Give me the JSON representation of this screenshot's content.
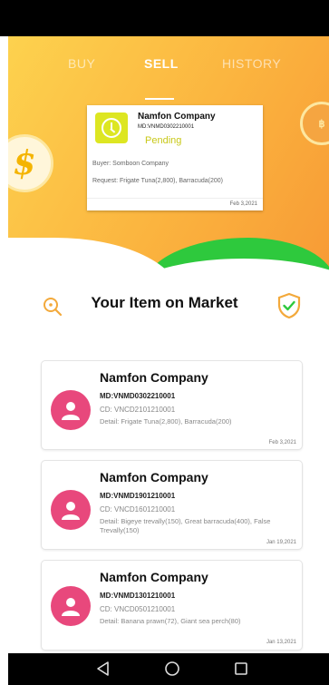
{
  "tabs": {
    "buy": "BUY",
    "sell": "SELL",
    "history": "HISTORY"
  },
  "pending_card": {
    "company": "Namfon Company",
    "md": "MD:VNMD0302210001",
    "status": "Pending",
    "buyer": "Buyer: Somboon Company",
    "request": "Request: Frigate Tuna(2,800), Barracuda(200)",
    "date": "Feb 3,2021"
  },
  "market": {
    "title": "Your Item on Market"
  },
  "items": [
    {
      "company": "Namfon Company",
      "md": "MD:VNMD0302210001",
      "cd": "CD: VNCD2101210001",
      "detail": "Detail: Frigate Tuna(2,800), Barracuda(200)",
      "date": "Feb 3,2021"
    },
    {
      "company": "Namfon Company",
      "md": "MD:VNMD1901210001",
      "cd": "CD: VNCD1601210001",
      "detail": "Detail: Bigeye trevally(150), Great barracuda(400), False Trevally(150)",
      "date": "Jan 19,2021"
    },
    {
      "company": "Namfon Company",
      "md": "MD:VNMD1301210001",
      "cd": "CD: VNCD0501210001",
      "detail": "Detail: Banana prawn(72), Giant sea perch(80)",
      "date": "Jan 13,2021"
    }
  ],
  "colors": {
    "accent": "#fbb43f",
    "avatar": "#e8487c",
    "pending": "#c8c818",
    "green": "#2ec93d"
  },
  "icons": {
    "search": "search-icon",
    "shield": "shield-check-icon",
    "avatar": "person-icon",
    "nav_back": "back-triangle-icon",
    "nav_home": "home-circle-icon",
    "nav_recent": "recent-square-icon"
  }
}
